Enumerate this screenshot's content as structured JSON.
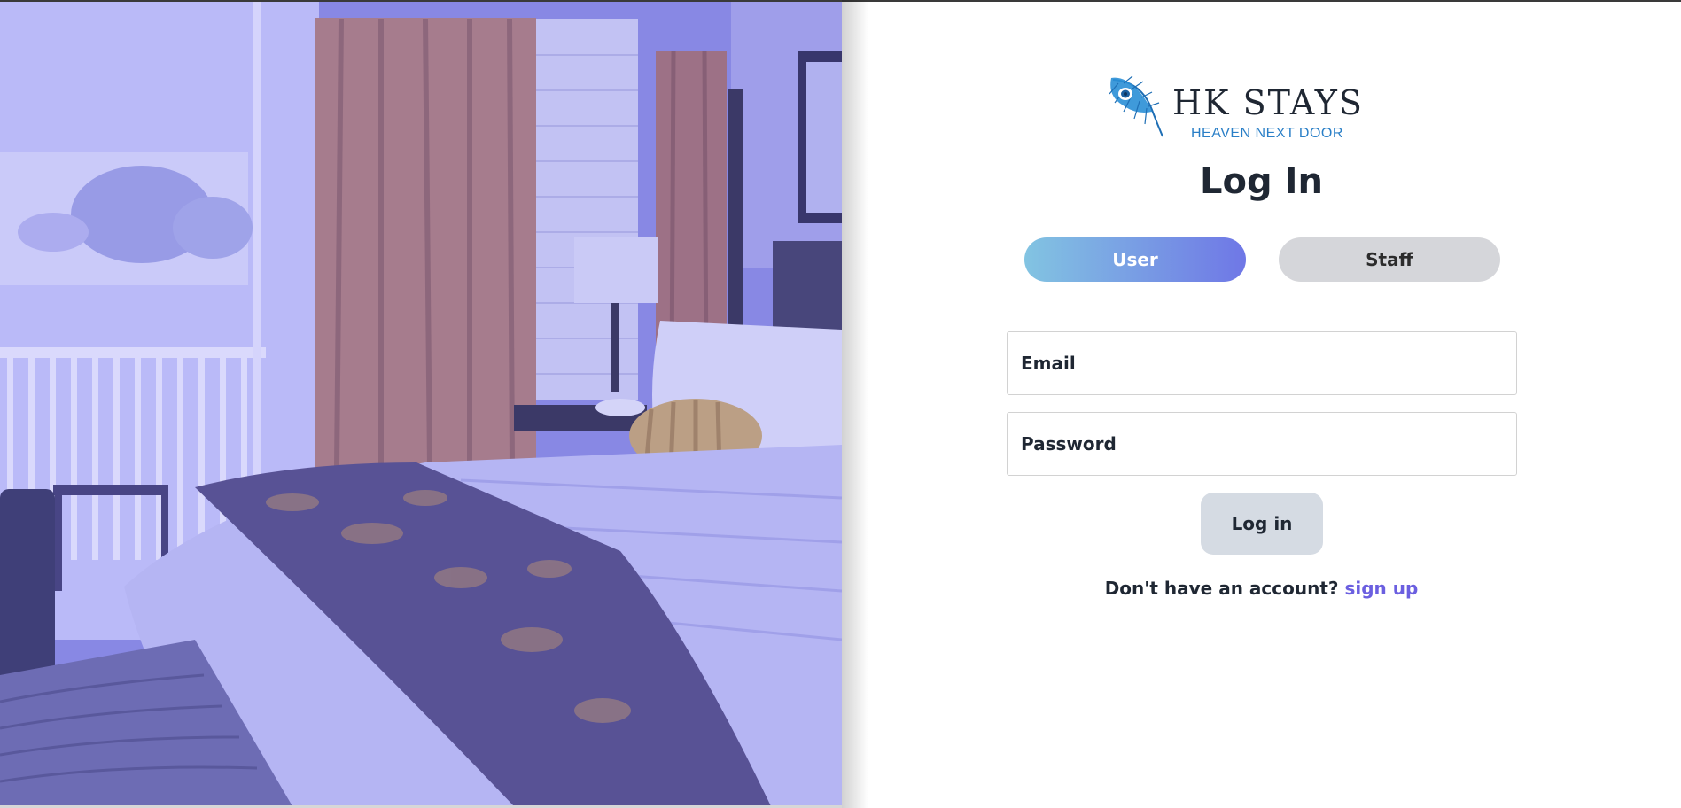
{
  "brand": {
    "name": "HK STAYS",
    "tagline": "HEAVEN NEXT DOOR",
    "logo_icon": "peacock-feather-icon",
    "accent_color": "#2a7fc7"
  },
  "hero": {
    "image_subject": "hotel-bedroom-photo",
    "tint_color": "#8d8de6"
  },
  "login": {
    "heading": "Log In",
    "roles": {
      "user_label": "User",
      "staff_label": "Staff",
      "selected": "User"
    },
    "email_placeholder": "Email",
    "password_placeholder": "Password",
    "submit_label": "Log in",
    "signup_prompt": "Don't have an account?",
    "signup_link": "sign up",
    "link_color": "#6b5fe0"
  }
}
